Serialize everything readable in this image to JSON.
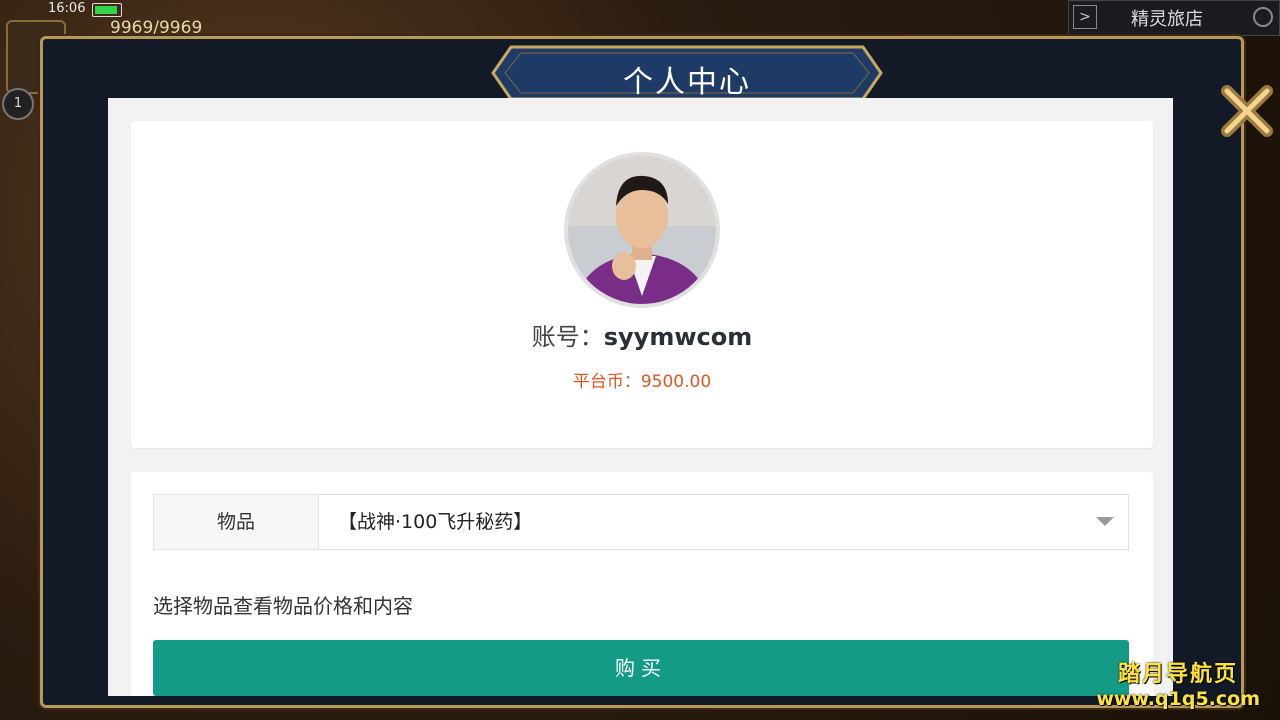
{
  "status_bar": {
    "time": "16:06"
  },
  "hud": {
    "stamina": "9969/9969",
    "level": "1",
    "location": "精灵旅店",
    "arrow_label": ">"
  },
  "dialog": {
    "title": "个人中心",
    "back_icon": "back-arrow-icon",
    "close_icon": "close-x-icon"
  },
  "profile": {
    "account_label": "账号：",
    "account_value": "syymwcom",
    "coin_label": "平台币：",
    "coin_value": "9500.00",
    "coin_color": "#e4561e"
  },
  "purchase": {
    "item_label": "物品",
    "selected_item": "【战神·100飞升秘药】",
    "hint": "选择物品查看物品价格和内容",
    "buy_label": "购买",
    "buy_color": "#149b86"
  },
  "watermark": {
    "title": "踏月导航页",
    "url": "www.q1q5.com"
  }
}
